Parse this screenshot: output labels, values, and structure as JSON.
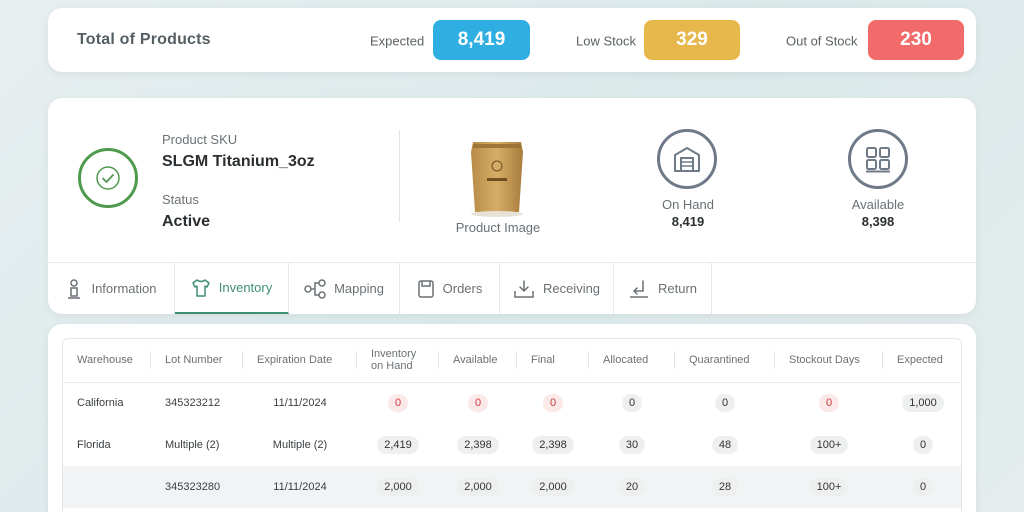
{
  "summary": {
    "title": "Total of Products",
    "expected_label": "Expected",
    "expected_value": "8,419",
    "low_stock_label": "Low Stock",
    "low_stock_value": "329",
    "out_of_stock_label": "Out of Stock",
    "out_of_stock_value": "230",
    "colors": {
      "expected": "#2faee2",
      "low_stock": "#e6b84b",
      "out_of_stock": "#f26a6a"
    }
  },
  "product": {
    "sku_label": "Product SKU",
    "sku_value": "SLGM Titanium_3oz",
    "status_label": "Status",
    "status_value": "Active",
    "image_label": "Product Image",
    "on_hand_label": "On Hand",
    "on_hand_value": "8,419",
    "available_label": "Available",
    "available_value": "8,398",
    "icons": {
      "status": "check-circle-icon",
      "on_hand": "warehouse-icon",
      "available": "boxes-icon"
    }
  },
  "tabs": [
    {
      "label": "Information",
      "icon": "info-person-icon"
    },
    {
      "label": "Inventory",
      "icon": "shirt-icon"
    },
    {
      "label": "Mapping",
      "icon": "mapping-icon"
    },
    {
      "label": "Orders",
      "icon": "orders-icon"
    },
    {
      "label": "Receiving",
      "icon": "receiving-icon"
    },
    {
      "label": "Return",
      "icon": "return-icon"
    }
  ],
  "active_tab": "Inventory",
  "table": {
    "headers": [
      "Warehouse",
      "Lot Number",
      "Expiration Date",
      "Inventory on Hand",
      "Available",
      "Final",
      "Allocated",
      "Quarantined",
      "Stockout Days",
      "Expected"
    ],
    "rows": [
      [
        "California",
        "345323212",
        "11/11/2024",
        "0",
        "0",
        "0",
        "0",
        "0",
        "0",
        "1,000"
      ],
      [
        "Florida",
        "Multiple (2)",
        "Multiple (2)",
        "2,419",
        "2,398",
        "2,398",
        "30",
        "48",
        "100+",
        "0"
      ],
      [
        "",
        "345323280",
        "11/11/2024",
        "2,000",
        "2,000",
        "2,000",
        "20",
        "28",
        "100+",
        "0"
      ]
    ]
  }
}
